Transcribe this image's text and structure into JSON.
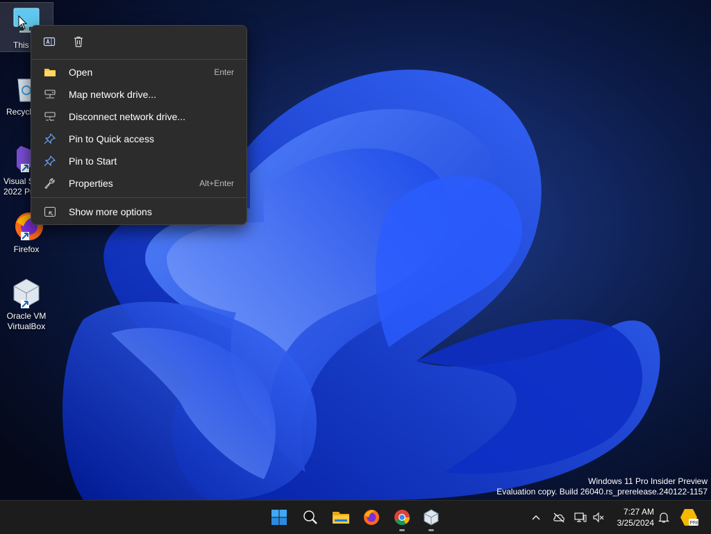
{
  "desktop": {
    "icons": [
      {
        "label": "This"
      },
      {
        "label": "Recycl"
      },
      {
        "label": "Visual S\n2022 Pr"
      },
      {
        "label": "Firefox"
      },
      {
        "label": "Oracle VM\nVirtualBox"
      }
    ]
  },
  "context_menu": {
    "quick_actions": [
      {
        "icon": "rename-icon"
      },
      {
        "icon": "delete-icon"
      }
    ],
    "items": [
      {
        "label": "Open",
        "shortcut": "Enter",
        "icon": "folder-icon"
      },
      {
        "label": "Map network drive...",
        "shortcut": "",
        "icon": "network-drive-icon"
      },
      {
        "label": "Disconnect network drive...",
        "shortcut": "",
        "icon": "disconnect-drive-icon"
      },
      {
        "label": "Pin to Quick access",
        "shortcut": "",
        "icon": "pin-icon"
      },
      {
        "label": "Pin to Start",
        "shortcut": "",
        "icon": "pin-icon"
      },
      {
        "label": "Properties",
        "shortcut": "Alt+Enter",
        "icon": "wrench-icon"
      }
    ],
    "more": {
      "label": "Show more options",
      "icon": "more-options-icon"
    }
  },
  "watermark": {
    "line1": "Windows 11 Pro Insider Preview",
    "line2": "Evaluation copy. Build 26040.rs_prerelease.240122-1157"
  },
  "taskbar": {
    "apps": [
      "start-icon",
      "search-icon",
      "file-explorer-icon",
      "firefox-icon",
      "chrome-icon",
      "virtualbox-icon"
    ],
    "clock": {
      "time": "7:27 AM",
      "date": "3/25/2024"
    },
    "badge": "PRE"
  },
  "colors": {
    "accent": "#1a5cff",
    "menu_bg": "#2c2c2c",
    "taskbar_bg": "#1c1c1c"
  }
}
